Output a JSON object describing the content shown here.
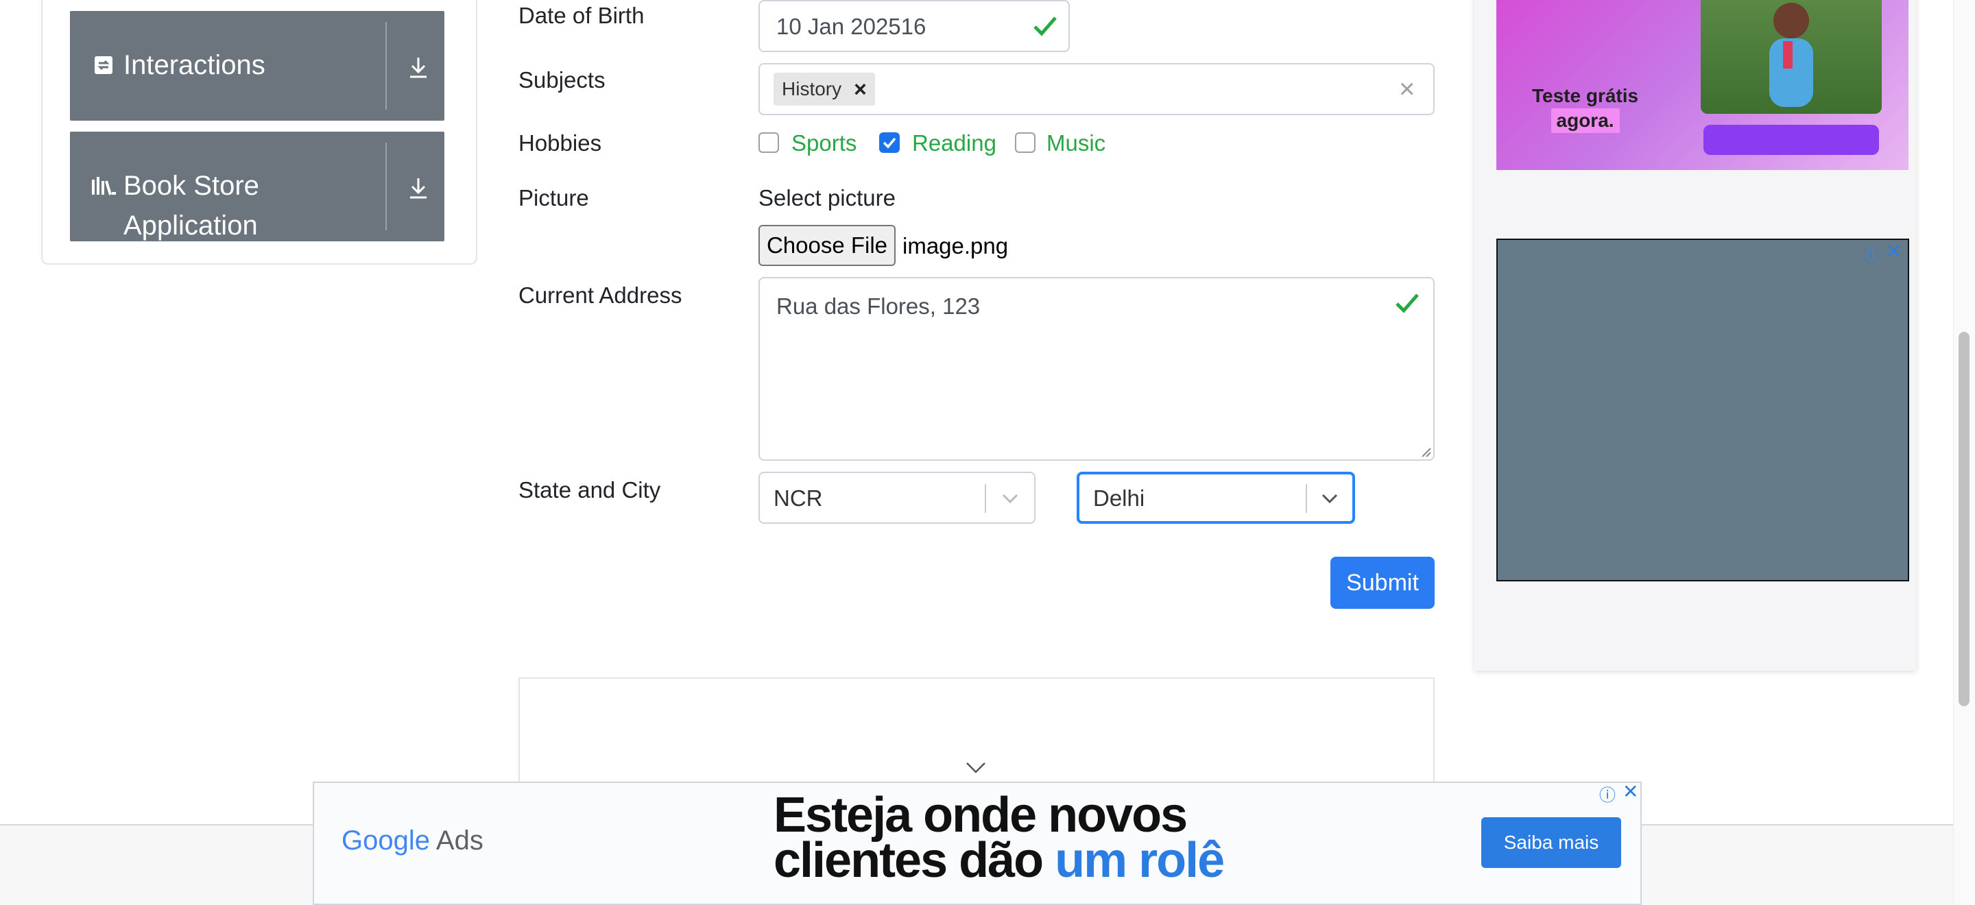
{
  "sidebar": {
    "groups": [
      {
        "label": "Interactions",
        "icon": "interactions-icon"
      },
      {
        "label_line1": "Book Store",
        "label_line2": "Application",
        "icon": "book-store-icon"
      }
    ]
  },
  "form": {
    "dob": {
      "label": "Date of Birth",
      "value": "10 Jan 202516"
    },
    "subjects": {
      "label": "Subjects",
      "chips": [
        "History"
      ],
      "chip_remove": "×",
      "clear": "×"
    },
    "hobbies": {
      "label": "Hobbies",
      "options": [
        {
          "label": "Sports",
          "checked": false
        },
        {
          "label": "Reading",
          "checked": true
        },
        {
          "label": "Music",
          "checked": false
        }
      ]
    },
    "picture": {
      "label": "Picture",
      "select_label": "Select picture",
      "button": "Choose File",
      "file_name": "image.png"
    },
    "address": {
      "label": "Current Address",
      "value": "Rua das Flores, 123"
    },
    "state_city": {
      "label": "State and City",
      "state": "NCR",
      "city": "Delhi"
    },
    "submit": "Submit"
  },
  "ads": {
    "top_text_line1": "Teste grátis",
    "top_text_line2": "agora.",
    "bottom": {
      "logo_google": "Google",
      "logo_ads": "Ads",
      "headline_line1": "Esteja onde novos",
      "headline_line2_a": "clientes dão ",
      "headline_line2_b": "um rolê",
      "cta": "Saiba mais"
    }
  },
  "colors": {
    "accent": "#2b7bf3",
    "success": "#28a745",
    "group_bg": "#6c757d"
  }
}
